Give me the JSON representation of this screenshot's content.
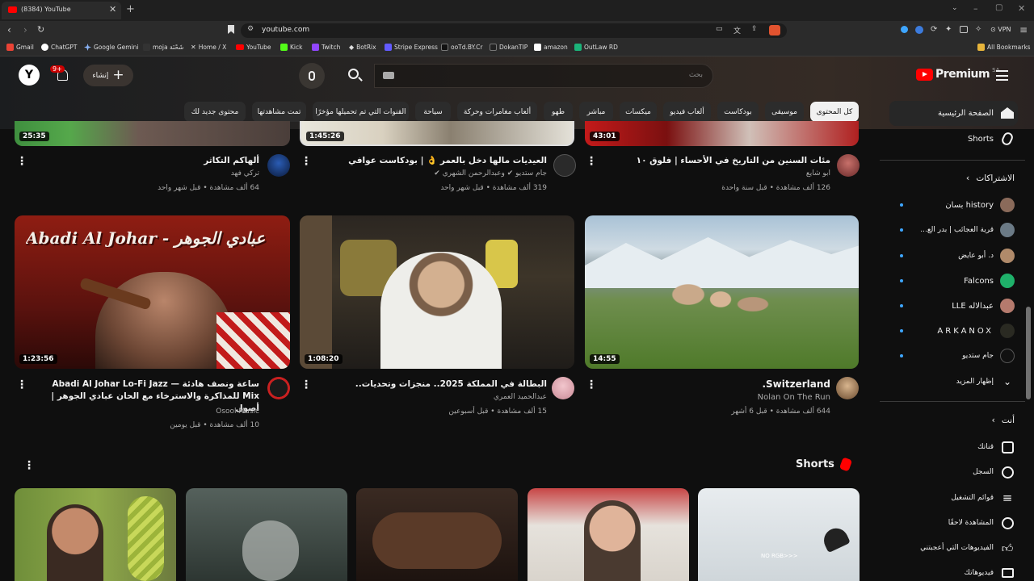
{
  "browser": {
    "tab_title": "(8384) YouTube",
    "url": "youtube.com",
    "vpn_label": "VPN",
    "bookmarks": [
      "Gmail",
      "ChatGPT",
      "Google Gemini",
      "moja شَحْنَة",
      "Home / X",
      "YouTube",
      "Kick",
      "Twitch",
      "BotRix",
      "Stripe Express",
      "ooTd.BY.Cr",
      "DokanTIP",
      "amazon",
      "OutLaw RD"
    ],
    "all_bookmarks": "All Bookmarks"
  },
  "header": {
    "logo_text": "Premium",
    "region": "SA",
    "search_placeholder": "بحث",
    "create_label": "إنشاء",
    "notif_count": "9+",
    "account_initial": "Y"
  },
  "chips": [
    "كل المحتوى",
    "موسيقى",
    "بودكاست",
    "ألعاب فيديو",
    "ميكسات",
    "مباشر",
    "طهو",
    "ألعاب مغامرات وحركة",
    "سياحة",
    "القنوات التي تم تحميلها مؤخرًا",
    "تمت مشاهدتها",
    "محتوى جديد لك"
  ],
  "sidebar": {
    "home": "الصفحة الرئيسية",
    "shorts": "Shorts",
    "subs_header": "الاشتراكات",
    "subs": [
      "history بسان",
      "قرية العجائب | بدر الع...",
      "د. أبو عايض",
      "Falcons",
      "عبدالاله LLE",
      "ARKANOX",
      "جام ستديو"
    ],
    "show_more": "إظهار المزيد",
    "you_header": "أنت",
    "you_items": [
      "قناتك",
      "السجل",
      "قوائم التشغيل",
      "المشاهدة لاحقًا",
      "الفيديوهات التي أعجبتني",
      "فيديوهاتك"
    ]
  },
  "row1": [
    {
      "duration": "25:35",
      "title": "ألهاكم التكاثر",
      "channel": "تركي فهد",
      "meta": "64 ألف مشاهدة • قبل شهر واحد"
    },
    {
      "duration": "1:45:26",
      "title": "العيديات مالها دخل بالعمر 👌 | بودكاست عوافي",
      "channel": "جام ستديو ✔ وعبدالرحمن الشهري ✔",
      "meta": "319 ألف مشاهدة • قبل شهر واحد"
    },
    {
      "duration": "43:01",
      "title": "مئات السنين من التاريخ في الأحساء | فلوق ١٠",
      "channel": "ابو شايع",
      "meta": "126 ألف مشاهدة • قبل سنة واحدة"
    }
  ],
  "row2": [
    {
      "duration": "1:23:56",
      "title": "ساعة ونصف هادئة — Abadi Al Johar Lo-Fi Jazz Mix للمذاكرة والاسترخاء مع الحان عبادي الجوهر | أصول",
      "channel": "Osool Music",
      "meta": "10 ألف مشاهدة • قبل يومين",
      "thumb_text": "Abadi Al Johar - عبادي الجوهر"
    },
    {
      "duration": "1:08:20",
      "title": "البطالة في المملكة 2025.. منجزات وتحديات..",
      "channel": "عبدالحميد العمري",
      "meta": "15 ألف مشاهدة • قبل أسبوعين"
    },
    {
      "duration": "14:55",
      "title": "Switzerland.",
      "channel": "Nolan On The Run",
      "meta": "644 ألف مشاهدة • قبل 6 أشهر"
    }
  ],
  "shorts_section": {
    "title": "Shorts",
    "short5_text": "NO RGB>>>"
  },
  "colors": {
    "accent": "#ff0000",
    "link": "#3ea6ff",
    "bg": "#0f0f0f"
  }
}
